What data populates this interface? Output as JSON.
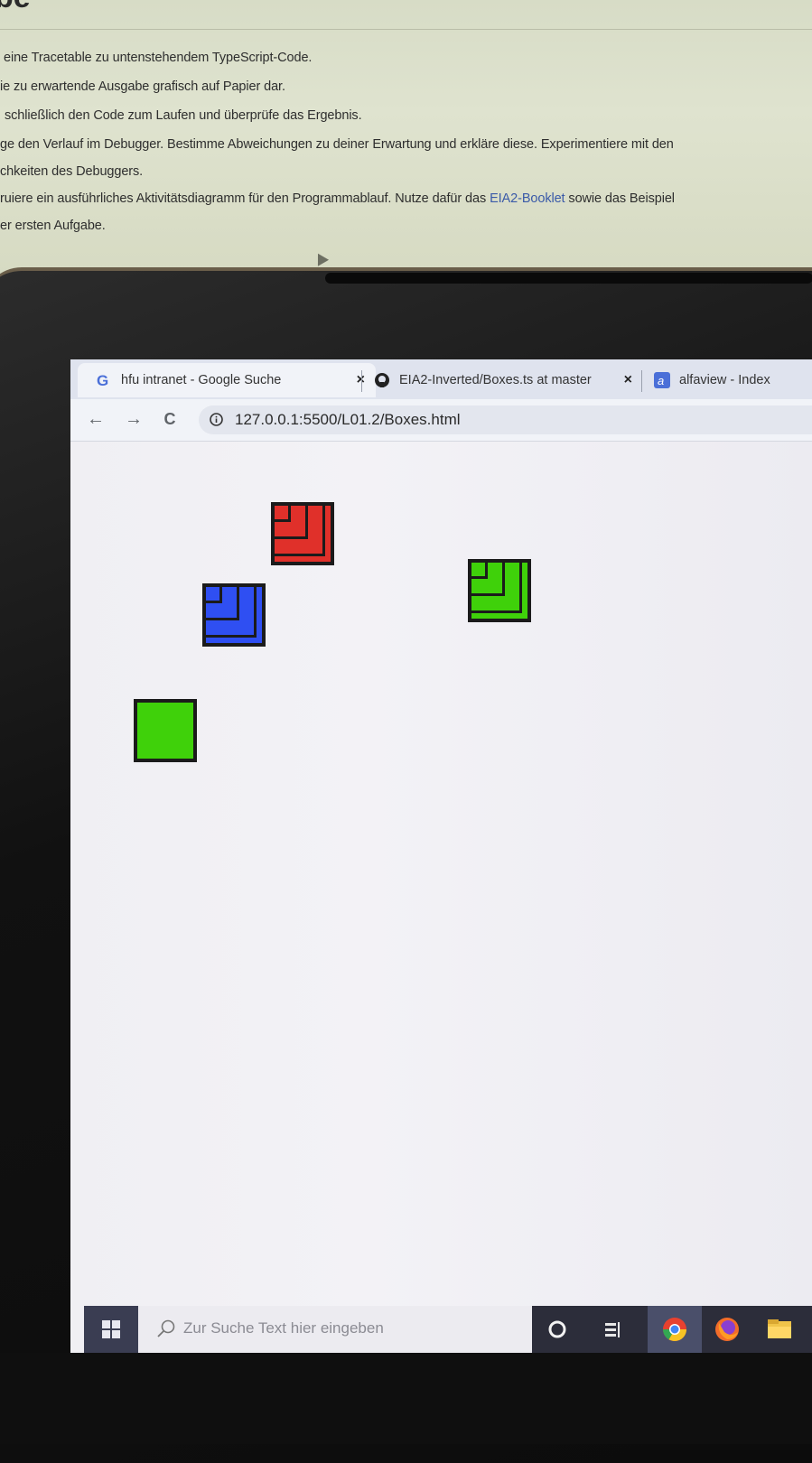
{
  "paper": {
    "heading": "be",
    "lines": [
      {
        "text": "eine Tracetable zu untenstehendem TypeScript-Code."
      },
      {
        "text": "ie zu erwartende Ausgabe grafisch auf Papier dar."
      },
      {
        "text": "schließlich den Code zum Laufen und überprüfe das Ergebnis."
      },
      {
        "text": "ge den Verlauf im Debugger. Bestimme Abweichungen zu deiner Erwartung und erkläre diese. Experimentiere mit den"
      },
      {
        "text": "chkeiten des Debuggers."
      },
      {
        "text_before": "ruiere ein ausführliches Aktivitätsdiagramm für den Programmablauf. Nutze dafür das ",
        "link": "EIA2-Booklet",
        "text_after": " sowie das Beispiel"
      },
      {
        "text": "er ersten Aufgabe."
      }
    ]
  },
  "browser": {
    "tabs": [
      {
        "title": "hfu intranet - Google Suche",
        "icon": "google-icon",
        "close": "×"
      },
      {
        "title": "EIA2-Inverted/Boxes.ts at master",
        "icon": "github-icon",
        "close": "×"
      },
      {
        "title": "alfaview - Index",
        "icon": "alfaview-icon"
      }
    ],
    "url": "127.0.0.1:5500/L01.2/Boxes.html",
    "nav": {
      "back": "←",
      "forward": "→",
      "reload": "C"
    }
  },
  "canvas": {
    "boxes": [
      {
        "color": "#e0302a",
        "nested": true
      },
      {
        "color": "#2f4ff2",
        "nested": true
      },
      {
        "color": "#3fd10a",
        "nested": true
      },
      {
        "color": "#3fd10a",
        "nested": false
      }
    ]
  },
  "taskbar": {
    "search_placeholder": "Zur Suche Text hier eingeben",
    "icons": [
      "windows-start-icon",
      "search-icon",
      "cortana-icon",
      "task-view-icon",
      "chrome-icon",
      "firefox-icon",
      "file-explorer-icon"
    ]
  },
  "colors": {
    "red_box": "#e0302a",
    "blue_box": "#2f4ff2",
    "green_box": "#3fd10a",
    "taskbar": "#2c2d3a"
  }
}
